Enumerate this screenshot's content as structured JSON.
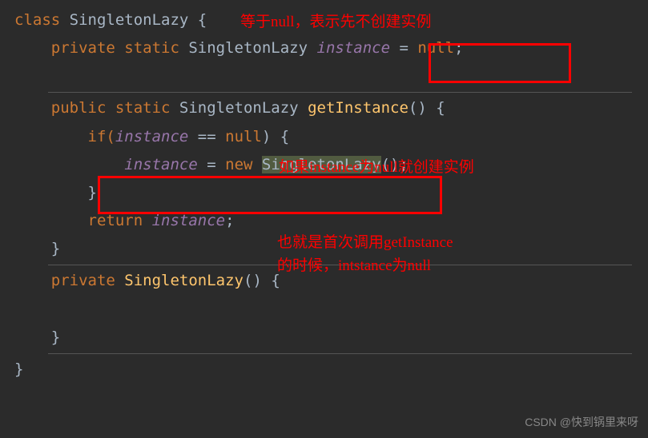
{
  "code": {
    "l1_class": "class ",
    "l1_name": "SingletonLazy",
    "l1_brace": " {",
    "l2_mod": "    private static ",
    "l2_type": "SingletonLazy ",
    "l2_var": "instance",
    "l2_eq": " = ",
    "l2_null": "null",
    "l2_semi": ";",
    "l4_mod": "    public static ",
    "l4_type": "SingletonLazy ",
    "l4_fn": "getInstance",
    "l4_paren": "() {",
    "l5_if": "        if(",
    "l5_var": "instance",
    "l5_eqnull": " == ",
    "l5_null": "null",
    "l5_close": ") {",
    "l6_pad": "            ",
    "l6_var": "instance",
    "l6_eq": " = ",
    "l6_new": "new ",
    "l6_cls": "SingletonLazy",
    "l6_paren": "();",
    "l7_cbrace": "        }",
    "l8_ret": "        return ",
    "l8_var": "instance",
    "l8_semi": ";",
    "l9_cbrace": "    }",
    "l10_mod": "    private ",
    "l10_fn": "SingletonLazy",
    "l10_paren": "() {",
    "l12_cbrace": "    }",
    "l13_cbrace": "}"
  },
  "annotations": {
    "a1": "等于null，表示先不创建实例",
    "a2": "如果instance为null就创建实例",
    "a3_l1": "也就是首次调用getInstance",
    "a3_l2": "的时候，intstance为null"
  },
  "watermark": "CSDN @快到锅里来呀"
}
